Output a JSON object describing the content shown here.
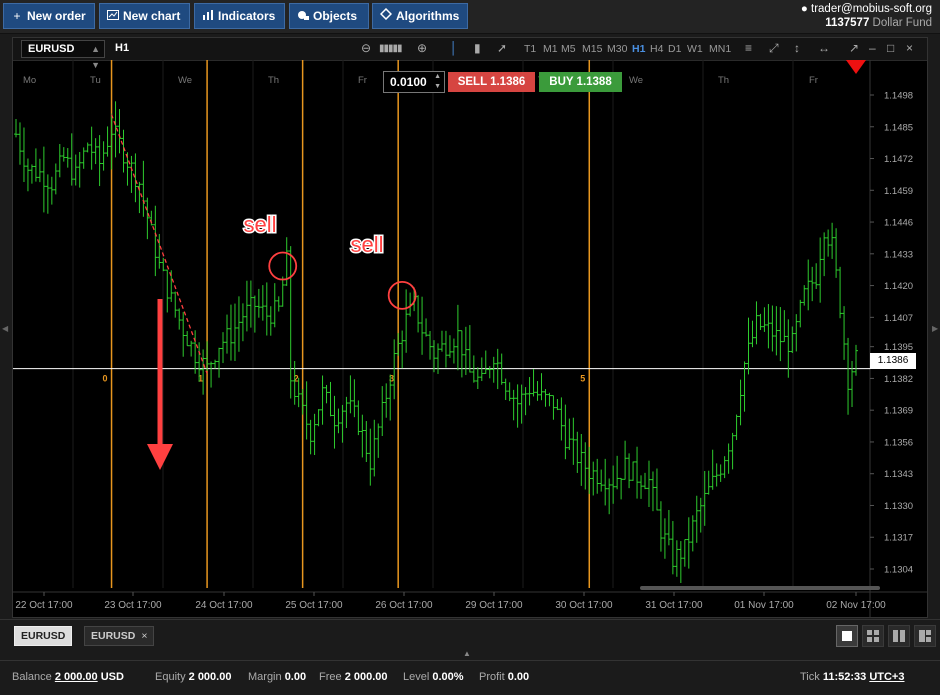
{
  "toolbar": {
    "new_order": "New order",
    "new_chart": "New chart",
    "indicators": "Indicators",
    "objects": "Objects",
    "algorithms": "Algorithms"
  },
  "account": {
    "user": "trader@mobius-soft.org",
    "number": "1137577",
    "fund": "Dollar Fund"
  },
  "chart_header": {
    "symbol": "EURUSD",
    "timeframe": "H1",
    "timeframes": [
      "T1",
      "M1",
      "M5",
      "M15",
      "M30",
      "H1",
      "H4",
      "D1",
      "W1",
      "MN1"
    ],
    "active_timeframe": "H1"
  },
  "order_panel": {
    "quantity": "0.0100",
    "sell_label": "SELL",
    "sell_price": "1.1386",
    "buy_label": "BUY",
    "buy_price": "1.1388"
  },
  "colors": {
    "candle": "#2ecc2e",
    "fib_line": "#e8961f",
    "annotation": "#ff4040",
    "sell": "#d64541",
    "buy": "#3b9b3b",
    "accent": "#1f4a80"
  },
  "chart_data": {
    "type": "candlestick",
    "symbol": "EURUSD",
    "timeframe": "H1",
    "y_ticks": [
      1.1498,
      1.1485,
      1.1472,
      1.1459,
      1.1446,
      1.1433,
      1.142,
      1.1407,
      1.1395,
      1.1382,
      1.1369,
      1.1356,
      1.1343,
      1.133,
      1.1317,
      1.1304
    ],
    "ylim": [
      1.1296,
      1.1504
    ],
    "x_ticks": [
      "22 Oct 17:00",
      "23 Oct 17:00",
      "24 Oct 17:00",
      "25 Oct 17:00",
      "26 Oct 17:00",
      "29 Oct 17:00",
      "30 Oct 17:00",
      "31 Oct 17:00",
      "01 Nov 17:00",
      "02 Nov 17:00"
    ],
    "day_labels": [
      "Mo",
      "Tu",
      "We",
      "Th",
      "Fr",
      "Mo",
      "Tu",
      "We",
      "Th",
      "Fr"
    ],
    "current_price": 1.1386,
    "close_path": [
      [
        0,
        1.1482
      ],
      [
        3,
        1.1468
      ],
      [
        6,
        1.1466
      ],
      [
        9,
        1.1462
      ],
      [
        12,
        1.1472
      ],
      [
        15,
        1.1465
      ],
      [
        18,
        1.1478
      ],
      [
        21,
        1.147
      ],
      [
        24,
        1.1484
      ],
      [
        26,
        1.1478
      ],
      [
        28,
        1.1471
      ],
      [
        31,
        1.1462
      ],
      [
        33,
        1.1448
      ],
      [
        36,
        1.1428
      ],
      [
        39,
        1.1414
      ],
      [
        42,
        1.1402
      ],
      [
        45,
        1.1392
      ],
      [
        48,
        1.1386
      ],
      [
        51,
        1.1396
      ],
      [
        54,
        1.14
      ],
      [
        57,
        1.1408
      ],
      [
        60,
        1.1412
      ],
      [
        63,
        1.1408
      ],
      [
        66,
        1.141
      ],
      [
        68,
        1.143
      ],
      [
        69,
        1.1382
      ],
      [
        71,
        1.1372
      ],
      [
        74,
        1.136
      ],
      [
        77,
        1.1376
      ],
      [
        80,
        1.1366
      ],
      [
        83,
        1.1372
      ],
      [
        86,
        1.1364
      ],
      [
        89,
        1.1348
      ],
      [
        92,
        1.1368
      ],
      [
        95,
        1.139
      ],
      [
        98,
        1.1406
      ],
      [
        100,
        1.1412
      ],
      [
        102,
        1.1402
      ],
      [
        105,
        1.1392
      ],
      [
        108,
        1.1396
      ],
      [
        111,
        1.14
      ],
      [
        114,
        1.1384
      ],
      [
        117,
        1.138
      ],
      [
        120,
        1.1392
      ],
      [
        123,
        1.138
      ],
      [
        126,
        1.1372
      ],
      [
        129,
        1.1378
      ],
      [
        132,
        1.1374
      ],
      [
        135,
        1.1372
      ],
      [
        138,
        1.1358
      ],
      [
        141,
        1.135
      ],
      [
        144,
        1.1344
      ],
      [
        147,
        1.1342
      ],
      [
        150,
        1.134
      ],
      [
        153,
        1.1346
      ],
      [
        156,
        1.1342
      ],
      [
        159,
        1.134
      ],
      [
        162,
        1.132
      ],
      [
        165,
        1.1308
      ],
      [
        168,
        1.1312
      ],
      [
        171,
        1.1326
      ],
      [
        174,
        1.1336
      ],
      [
        177,
        1.1346
      ],
      [
        180,
        1.136
      ],
      [
        183,
        1.1388
      ],
      [
        186,
        1.1404
      ],
      [
        189,
        1.1402
      ],
      [
        192,
        1.1398
      ],
      [
        195,
        1.1396
      ],
      [
        198,
        1.1416
      ],
      [
        201,
        1.1424
      ],
      [
        203,
        1.1444
      ],
      [
        205,
        1.1436
      ],
      [
        207,
        1.1412
      ],
      [
        209,
        1.1382
      ],
      [
        211,
        1.139
      ]
    ],
    "fib_levels": [
      {
        "label": "0",
        "bar": 24
      },
      {
        "label": "1",
        "bar": 48
      },
      {
        "label": "2",
        "bar": 72
      },
      {
        "label": "3",
        "bar": 96
      },
      {
        "label": "5",
        "bar": 144
      }
    ],
    "annotations": [
      {
        "text": "sell",
        "marker": "circle",
        "bar": 67,
        "price": 1.1428
      },
      {
        "text": "sell",
        "marker": "circle",
        "bar": 97,
        "price": 1.1416
      }
    ],
    "down_arrow": true
  },
  "tabs": [
    {
      "label": "EURUSD",
      "active": true
    },
    {
      "label": "EURUSD",
      "active": false
    }
  ],
  "status": {
    "balance_label": "Balance",
    "balance_value": "2 000.00",
    "balance_ccy": "USD",
    "equity_label": "Equity",
    "equity_value": "2 000.00",
    "margin_label": "Margin",
    "margin_value": "0.00",
    "free_label": "Free",
    "free_value": "2 000.00",
    "level_label": "Level",
    "level_value": "0.00%",
    "profit_label": "Profit",
    "profit_value": "0.00",
    "tick_label": "Tick",
    "time": "11:52:33",
    "tz": "UTC+3"
  }
}
